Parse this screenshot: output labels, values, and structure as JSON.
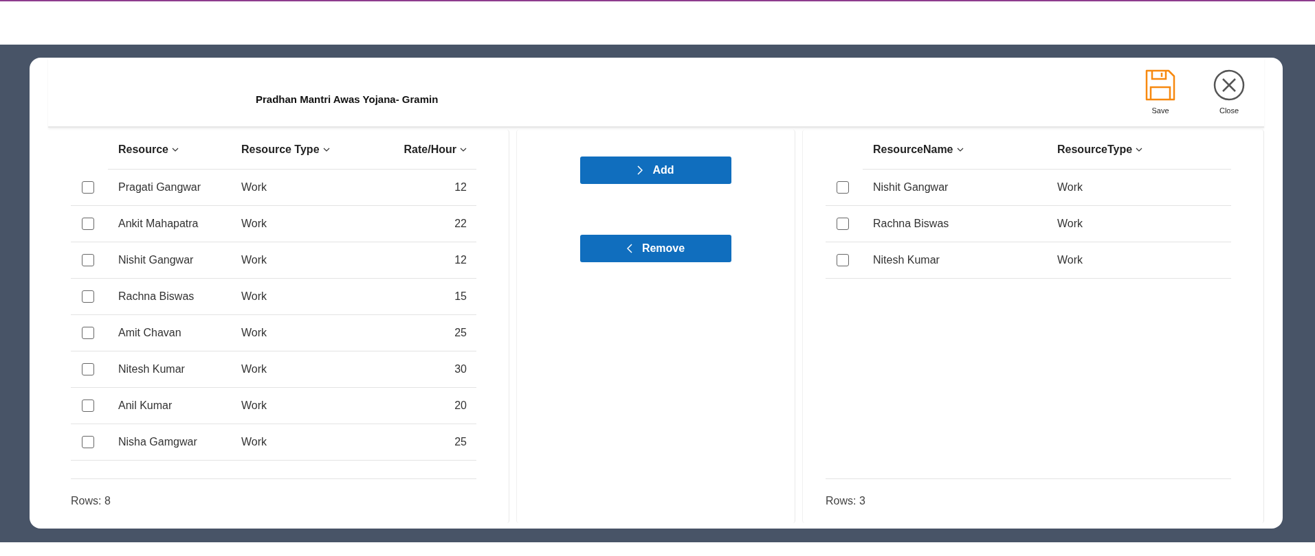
{
  "dialog": {
    "title": "Pradhan Mantri Awas Yojana- Gramin",
    "actions": [
      {
        "kind": "save",
        "label": "Save"
      },
      {
        "kind": "close",
        "label": "Close"
      }
    ]
  },
  "available": {
    "columns": [
      {
        "label": "Resource",
        "numeric": false
      },
      {
        "label": "Resource Type",
        "numeric": false
      },
      {
        "label": "Rate/Hour",
        "numeric": true
      }
    ],
    "rows": [
      {
        "checked": false,
        "cells": [
          "Pragati Gangwar",
          "Work",
          "12"
        ]
      },
      {
        "checked": false,
        "cells": [
          "Ankit Mahapatra",
          "Work",
          "22"
        ]
      },
      {
        "checked": false,
        "cells": [
          "Nishit Gangwar",
          "Work",
          "12"
        ]
      },
      {
        "checked": false,
        "cells": [
          "Rachna Biswas",
          "Work",
          "15"
        ]
      },
      {
        "checked": false,
        "cells": [
          "Amit Chavan",
          "Work",
          "25"
        ]
      },
      {
        "checked": false,
        "cells": [
          "Nitesh Kumar",
          "Work",
          "30"
        ]
      },
      {
        "checked": false,
        "cells": [
          "Anil Kumar",
          "Work",
          "20"
        ]
      },
      {
        "checked": false,
        "cells": [
          "Nisha Gamgwar",
          "Work",
          "25"
        ]
      }
    ],
    "footer": "Rows: 8"
  },
  "buttons": [
    {
      "kind": "add",
      "label": "Add"
    },
    {
      "kind": "remove",
      "label": "Remove"
    }
  ],
  "assigned": {
    "columns": [
      {
        "label": "ResourceName",
        "numeric": false
      },
      {
        "label": "ResourceType",
        "numeric": false
      }
    ],
    "rows": [
      {
        "checked": false,
        "cells": [
          "Nishit Gangwar",
          "Work"
        ]
      },
      {
        "checked": false,
        "cells": [
          "Rachna Biswas",
          "Work"
        ]
      },
      {
        "checked": false,
        "cells": [
          "Nitesh Kumar",
          "Work"
        ]
      }
    ],
    "footer": "Rows: 3"
  }
}
